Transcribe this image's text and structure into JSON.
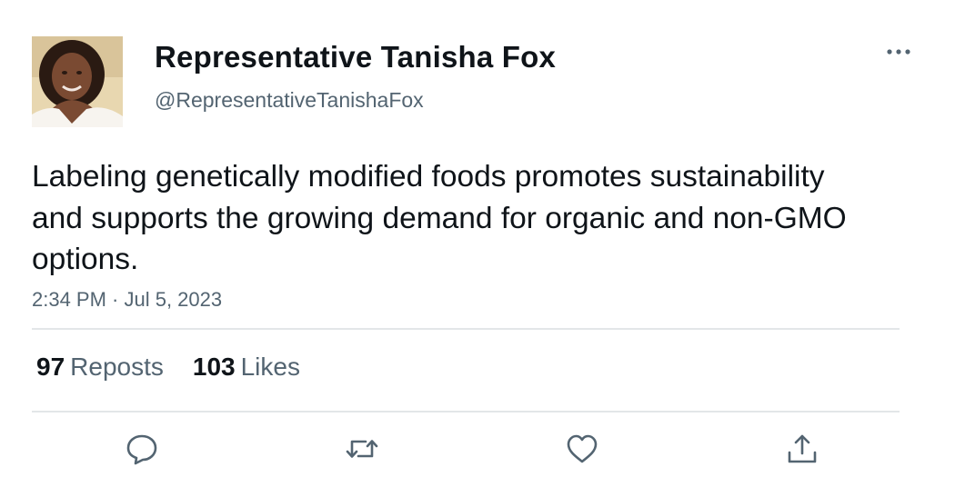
{
  "author": {
    "name": "Representative Tanisha Fox",
    "handle": "@RepresentativeTanishaFox",
    "avatar_icon": "profile-photo"
  },
  "tweet": {
    "text": "Labeling genetically modified foods promotes sustainability and supports the growing demand for organic and non-GMO options.",
    "timestamp": "2:34 PM · Jul 5, 2023"
  },
  "stats": {
    "reposts_count": "97",
    "reposts_label": "Reposts",
    "likes_count": "103",
    "likes_label": "Likes"
  },
  "actions": [
    {
      "name": "reply",
      "icon": "speech-bubble-icon"
    },
    {
      "name": "repost",
      "icon": "repost-arrows-icon"
    },
    {
      "name": "like",
      "icon": "heart-icon"
    },
    {
      "name": "share",
      "icon": "share-upload-icon"
    }
  ],
  "colors": {
    "primary_text": "#0f1419",
    "secondary_text": "#536471",
    "divider": "#e3e6e8",
    "icon": "#536471"
  }
}
